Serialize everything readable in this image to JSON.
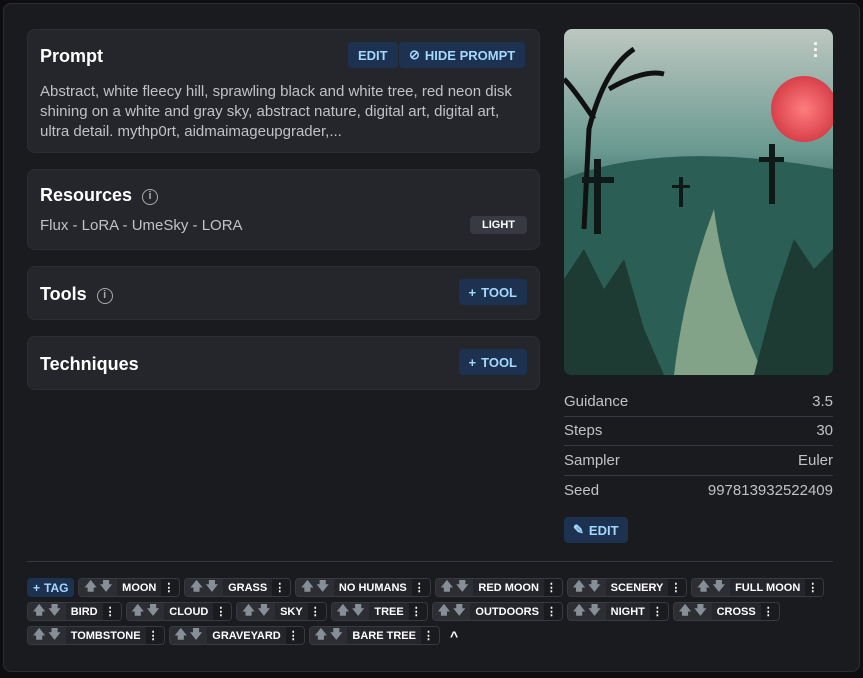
{
  "prompt": {
    "title": "Prompt",
    "edit": "EDIT",
    "hide": "HIDE PROMPT",
    "text": "Abstract, white fleecy hill, sprawling black and white tree, red neon disk shining on a white and gray sky, abstract nature, digital art, digital art, ultra detail. mythp0rt, aidmaimageupgrader,..."
  },
  "resources": {
    "title": "Resources",
    "item": "Flux - LoRA - UmeSky - LORA",
    "badge": "LIGHT"
  },
  "tools": {
    "title": "Tools",
    "add": "TOOL"
  },
  "techniques": {
    "title": "Techniques",
    "add": "TOOL"
  },
  "params": [
    {
      "label": "Guidance",
      "value": "3.5"
    },
    {
      "label": "Steps",
      "value": "30"
    },
    {
      "label": "Sampler",
      "value": "Euler"
    },
    {
      "label": "Seed",
      "value": "997813932522409"
    }
  ],
  "edit_button": "EDIT",
  "add_tag": "TAG",
  "tags": [
    "MOON",
    "GRASS",
    "NO HUMANS",
    "RED MOON",
    "SCENERY",
    "FULL MOON",
    "BIRD",
    "CLOUD",
    "SKY",
    "TREE",
    "OUTDOORS",
    "NIGHT",
    "CROSS",
    "TOMBSTONE",
    "GRAVEYARD",
    "BARE TREE"
  ]
}
